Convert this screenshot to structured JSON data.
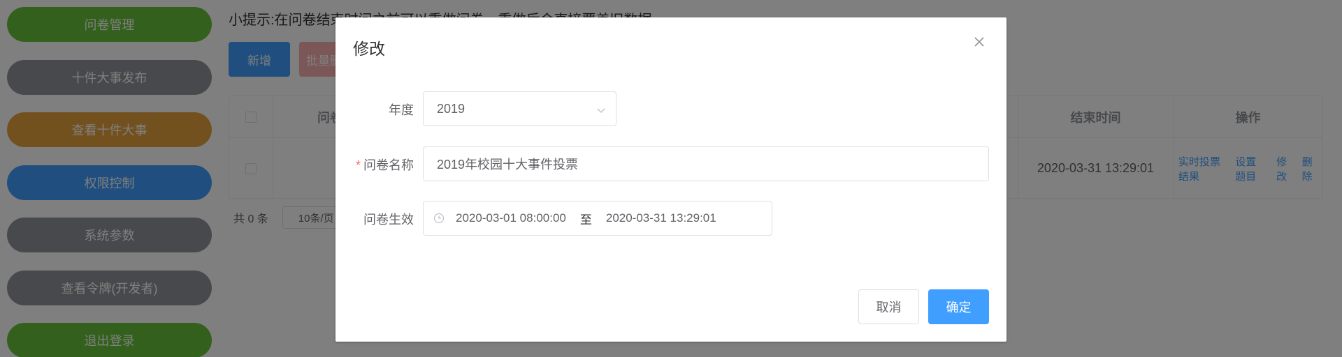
{
  "sidebar": {
    "items": [
      {
        "label": "问卷管理",
        "color": "#67c23a"
      },
      {
        "label": "十件大事发布",
        "color": "#909399"
      },
      {
        "label": "查看十件大事",
        "color": "#e6a23c"
      },
      {
        "label": "权限控制",
        "color": "#409eff"
      },
      {
        "label": "系统参数",
        "color": "#909399"
      },
      {
        "label": "查看令牌(开发者)",
        "color": "#909399"
      },
      {
        "label": "退出登录",
        "color": "#67c23a"
      }
    ]
  },
  "main": {
    "tip": "小提示:在问卷结束时间之前可以重做问卷，重做后会直接覆盖旧数据",
    "add_label": "新增",
    "batch_delete_label": "批量删除",
    "table": {
      "columns": [
        "问卷名称",
        "结束时间",
        "操作"
      ],
      "rows": [
        {
          "end_time": "2020-03-31 13:29:01",
          "actions": [
            "实时投票结果",
            "设置题目",
            "修改",
            "删除"
          ]
        }
      ]
    },
    "pager": {
      "total": "共 0 条",
      "page_size": "10条/页"
    }
  },
  "dialog": {
    "title": "修改",
    "year_label": "年度",
    "year_value": "2019",
    "name_label": "问卷名称",
    "name_value": "2019年校园十大事件投票",
    "valid_label": "问卷生效",
    "start_date": "2020-03-01 08:00:00",
    "range_separator": "至",
    "end_date": "2020-03-31 13:29:01",
    "cancel_label": "取消",
    "ok_label": "确定"
  },
  "icons": {
    "close": "close-icon",
    "clock": "clock-icon",
    "dropdown": "chevron-down-icon"
  },
  "colors": {
    "primary": "#409eff",
    "danger": "#f56c6c",
    "success": "#67c23a",
    "warning": "#e6a23c",
    "info": "#909399"
  }
}
